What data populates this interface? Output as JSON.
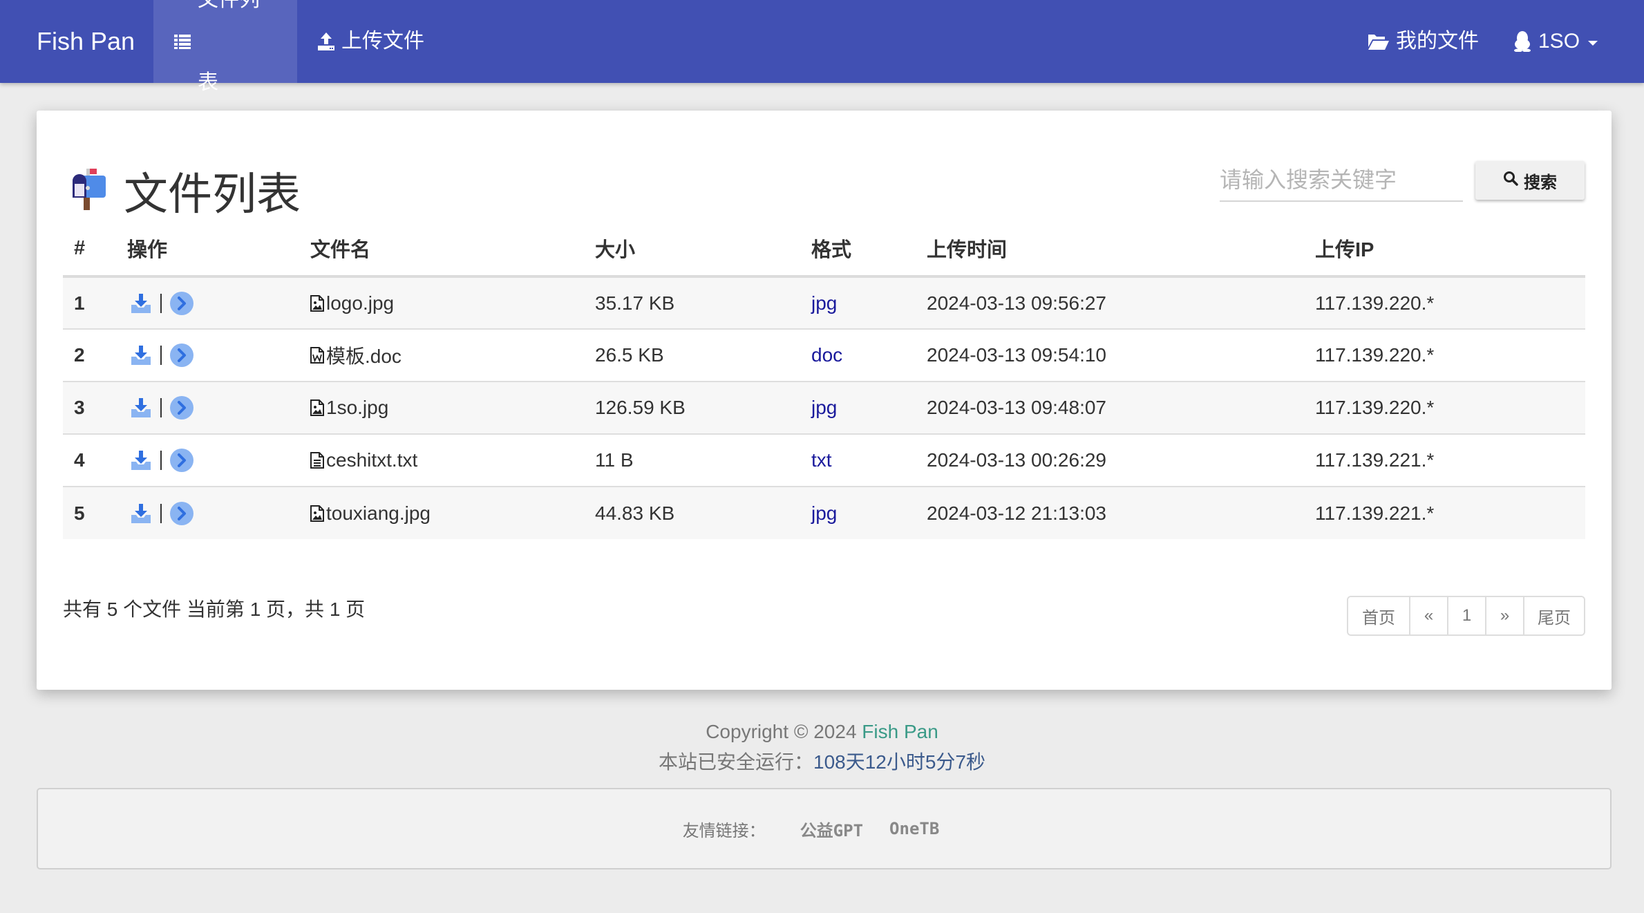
{
  "navbar": {
    "brand": "Fish Pan",
    "items": [
      {
        "label": "文件列表",
        "icon": "list-icon",
        "active": true
      },
      {
        "label": "上传文件",
        "icon": "upload-icon",
        "active": false
      }
    ],
    "right_items": [
      {
        "label": "我的文件",
        "icon": "folder-open-icon"
      },
      {
        "label": "1SO",
        "icon": "qq-penguin-icon",
        "dropdown": true
      }
    ]
  },
  "page": {
    "title": "文件列表",
    "title_icon": "mailbox-icon",
    "search": {
      "placeholder": "请输入搜索关键字",
      "value": "",
      "button_label": "搜索"
    }
  },
  "table": {
    "headers": [
      "#",
      "操作",
      "文件名",
      "大小",
      "格式",
      "上传时间",
      "上传IP"
    ],
    "rows": [
      {
        "num": "1",
        "name": "logo.jpg",
        "file_icon": "file-image-icon",
        "size": "35.17 KB",
        "format": "jpg",
        "time": "2024-03-13 09:56:27",
        "ip": "117.139.220.*"
      },
      {
        "num": "2",
        "name": "模板.doc",
        "file_icon": "file-word-icon",
        "size": "26.5 KB",
        "format": "doc",
        "time": "2024-03-13 09:54:10",
        "ip": "117.139.220.*"
      },
      {
        "num": "3",
        "name": "1so.jpg",
        "file_icon": "file-image-icon",
        "size": "126.59 KB",
        "format": "jpg",
        "time": "2024-03-13 09:48:07",
        "ip": "117.139.220.*"
      },
      {
        "num": "4",
        "name": "ceshitxt.txt",
        "file_icon": "file-text-icon",
        "size": "11 B",
        "format": "txt",
        "time": "2024-03-13 00:26:29",
        "ip": "117.139.221.*"
      },
      {
        "num": "5",
        "name": "touxiang.jpg",
        "file_icon": "file-image-icon",
        "size": "44.83 KB",
        "format": "jpg",
        "time": "2024-03-12 21:13:03",
        "ip": "117.139.221.*"
      }
    ]
  },
  "summary": "共有 5 个文件  当前第 1 页，共 1 页",
  "pagination": {
    "first": "首页",
    "prev": "«",
    "current": "1",
    "next": "»",
    "last": "尾页"
  },
  "footer": {
    "copyright_prefix": "Copyright © 2024 ",
    "copyright_brand": "Fish Pan",
    "running_label": "本站已安全运行：",
    "running_value": "108天12小时5分7秒",
    "links_label": "友情链接：",
    "links": [
      "公益GPT",
      "OneTB"
    ]
  },
  "colors": {
    "navbar": "#4150b3",
    "navbar_active": "#5865bd",
    "format_link": "#1a1a9c",
    "footer_brand": "#3a9a87",
    "uptime": "#3b5a8c",
    "action_icon": "#2f6fe0"
  }
}
